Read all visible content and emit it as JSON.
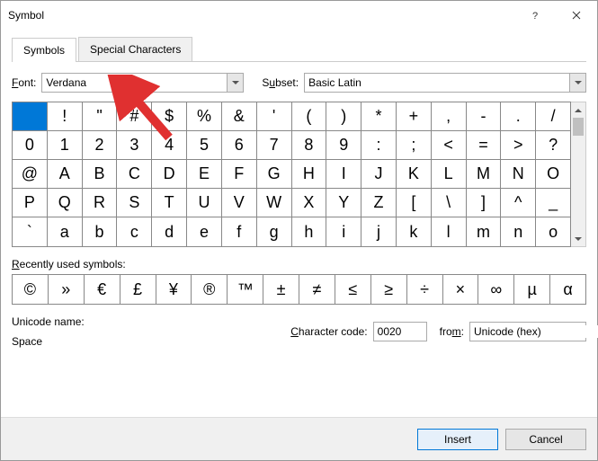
{
  "title": "Symbol",
  "tabs": {
    "symbols": "Symbols",
    "special": "Special Characters"
  },
  "font": {
    "label": "Font:",
    "value": "Verdana"
  },
  "subset": {
    "label": "Subset:",
    "value": "Basic Latin"
  },
  "grid": [
    [
      " ",
      "!",
      "\"",
      "#",
      "$",
      "%",
      "&",
      "'",
      "(",
      ")",
      "*",
      "+",
      ",",
      "-",
      ".",
      "/"
    ],
    [
      "0",
      "1",
      "2",
      "3",
      "4",
      "5",
      "6",
      "7",
      "8",
      "9",
      ":",
      ";",
      "<",
      "=",
      ">",
      "?"
    ],
    [
      "@",
      "A",
      "B",
      "C",
      "D",
      "E",
      "F",
      "G",
      "H",
      "I",
      "J",
      "K",
      "L",
      "M",
      "N",
      "O"
    ],
    [
      "P",
      "Q",
      "R",
      "S",
      "T",
      "U",
      "V",
      "W",
      "X",
      "Y",
      "Z",
      "[",
      "\\",
      "]",
      "^",
      "_"
    ],
    [
      "`",
      "a",
      "b",
      "c",
      "d",
      "e",
      "f",
      "g",
      "h",
      "i",
      "j",
      "k",
      "l",
      "m",
      "n",
      "o"
    ]
  ],
  "selected": {
    "row": 0,
    "col": 0
  },
  "recent_label": "Recently used symbols:",
  "recent": [
    "©",
    "»",
    "€",
    "£",
    "¥",
    "®",
    "™",
    "±",
    "≠",
    "≤",
    "≥",
    "÷",
    "×",
    "∞",
    "µ",
    "α"
  ],
  "unicode_name_label": "Unicode name:",
  "unicode_name_value": "Space",
  "char_code_label": "Character code:",
  "char_code_value": "0020",
  "from_label": "from:",
  "from_value": "Unicode (hex)",
  "buttons": {
    "insert": "Insert",
    "cancel": "Cancel"
  }
}
